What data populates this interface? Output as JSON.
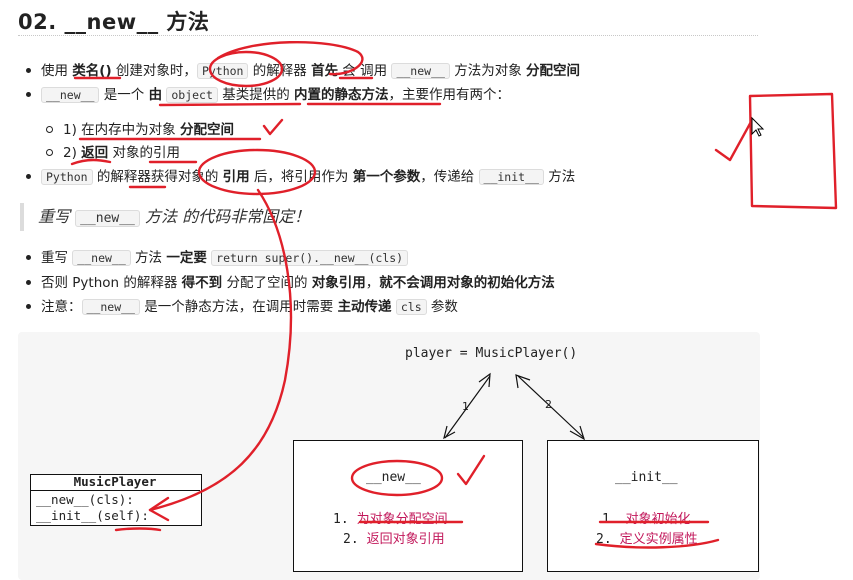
{
  "title": "02. __new__ 方法",
  "bullets1": {
    "b1": {
      "t1": "使用 ",
      "t2": "类名()",
      "t3": " 创建对象时，",
      "c1": "Python",
      "t4": " 的解释器 ",
      "t5": "首先",
      "t6": " 会 调用 ",
      "c2": "__new__",
      "t7": " 方法为对象 ",
      "t8": "分配空间"
    },
    "b2": {
      "c1": "__new__",
      "t1": " 是一个 ",
      "t2": "由",
      "c2": "object",
      "t3": " 基类提供的 ",
      "t4": "内置的静态方法",
      "t5": "，主要作用有两个："
    },
    "s1": {
      "t1": "1) 在内存中为对象 ",
      "t2": "分配空间"
    },
    "s2": {
      "t1": "2) ",
      "t2": "返回",
      "t3": " 对象的引用"
    },
    "b3": {
      "c1": "Python",
      "t1": " 的解释器获得对象的 ",
      "t2": "引用",
      "t3": " 后，将引用作为 ",
      "t4": "第一个参数",
      "t5": "，传递给 ",
      "c2": "__init__",
      "t6": " 方法"
    }
  },
  "quote": {
    "t1": "重写 ",
    "c1": "__new__",
    "t2": " 方法 的代码非常固定！"
  },
  "bullets2": {
    "b1": {
      "t1": "重写 ",
      "c1": "__new__",
      "t2": " 方法 ",
      "t3": "一定要",
      "c2": "return super().__new__(cls)"
    },
    "b2": {
      "t1": "否则 Python 的解释器 ",
      "t2": "得不到",
      "t3": " 分配了空间的 ",
      "t4": "对象引用",
      "t5": "，",
      "t6": "就不会调用对象的初始化方法"
    },
    "b3": {
      "t1": "注意：",
      "c1": "__new__",
      "t2": " 是一个静态方法，在调用时需要 ",
      "t3": "主动传递",
      "c2": "cls",
      "t4": " 参数"
    }
  },
  "diagram": {
    "player": "player = MusicPlayer()",
    "label1": "1",
    "label2": "2",
    "class_name": "MusicPlayer",
    "method1": "__new__(cls):",
    "method2": "__init__(self):",
    "new_title": "__new__",
    "new_steps": [
      {
        "n": "1.",
        "t": "为对象分配空间"
      },
      {
        "n": "2.",
        "t": "返回对象引用"
      }
    ],
    "init_title": "__init__",
    "init_steps": [
      {
        "n": "1.",
        "t": "对象初始化"
      },
      {
        "n": "2.",
        "t": "定义实例属性"
      }
    ]
  },
  "colors": {
    "ink": "#e0202a",
    "step_text": "#c2185b"
  }
}
